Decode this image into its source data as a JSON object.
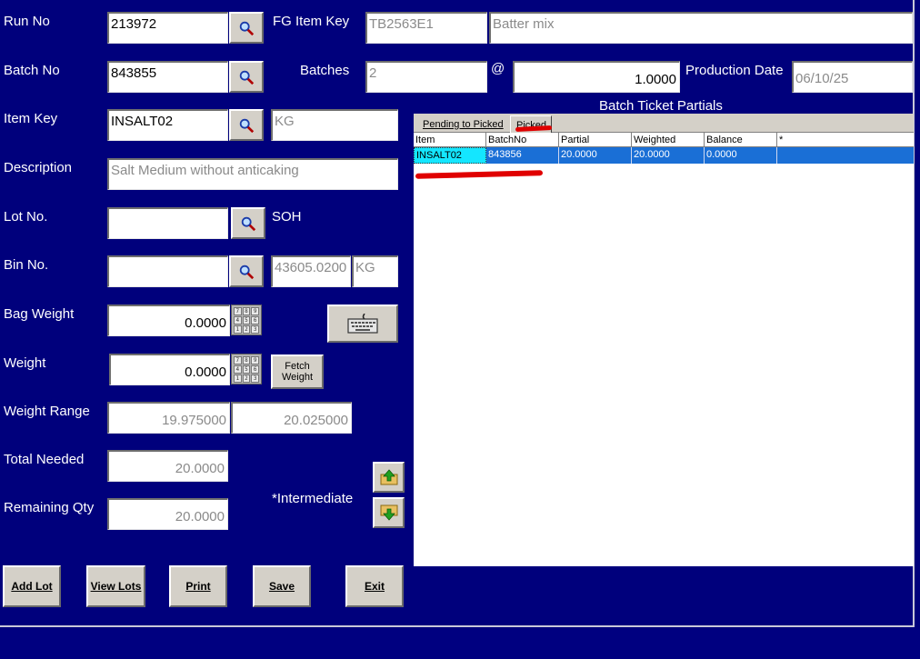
{
  "form": {
    "run_no": {
      "label": "Run No",
      "value": "213972"
    },
    "batch_no": {
      "label": "Batch No",
      "value": "843855"
    },
    "item_key": {
      "label": "Item Key",
      "value": "INSALT02",
      "uom": "KG"
    },
    "description": {
      "label": "Description",
      "value": "Salt Medium without anticaking"
    },
    "lot_no": {
      "label": "Lot No.",
      "value": "",
      "soh_label": "SOH"
    },
    "bin_no": {
      "label": "Bin No.",
      "value": "",
      "soh_value": "43605.0200",
      "soh_uom": "KG"
    },
    "bag_weight": {
      "label": "Bag Weight",
      "value": "0.0000"
    },
    "weight": {
      "label": "Weight",
      "value": "0.0000"
    },
    "weight_range": {
      "label": "Weight Range",
      "min": "19.975000",
      "max": "20.025000"
    },
    "total_needed": {
      "label": "Total Needed",
      "value": "20.0000"
    },
    "remaining_qty": {
      "label": "Remaining Qty",
      "value": "20.0000"
    },
    "fg_item_key": {
      "label": "FG Item Key",
      "value": "TB2563E1",
      "name": "Batter mix"
    },
    "batches": {
      "label": "Batches",
      "value": "2",
      "at": "@",
      "qty": "1.0000"
    },
    "production_date": {
      "label": "Production Date",
      "value": "06/10/25"
    },
    "intermediate_label": "*Intermediate"
  },
  "buttons": {
    "fetch_weight": [
      "Fetch",
      "Weight"
    ],
    "add_lot": "Add Lot",
    "view_lots": "View Lots",
    "print": "Print",
    "save": "Save",
    "exit": "Exit"
  },
  "partials": {
    "title": "Batch Ticket Partials",
    "tabs": [
      "Pending to Picked",
      "Picked"
    ],
    "active_tab": "Picked",
    "columns": [
      "Item",
      "BatchNo",
      "Partial",
      "Weighted",
      "Balance",
      "*"
    ],
    "rows": [
      {
        "item": "INSALT02",
        "batch_no": "843856",
        "partial": "20.0000",
        "weighted": "20.0000",
        "balance": "0.0000",
        "extra": ""
      }
    ]
  },
  "colors": {
    "background": "#00007c",
    "selected_row": "#1a6fd6",
    "selected_cell": "#14e6ff",
    "annotation": "#e00000"
  },
  "icons": [
    "search-icon",
    "numpad-icon",
    "keyboard-icon",
    "arrow-up-icon",
    "arrow-down-icon"
  ]
}
